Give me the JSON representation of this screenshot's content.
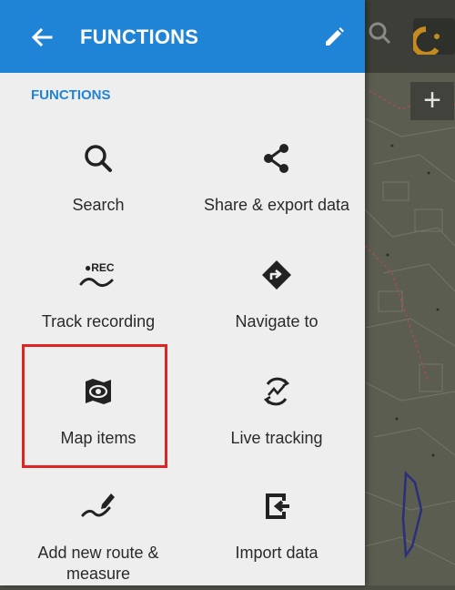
{
  "header": {
    "title": "FUNCTIONS",
    "back_icon": "arrow-back-icon",
    "edit_icon": "pencil-icon",
    "background_color": "#1f84d6"
  },
  "section": {
    "title": "FUNCTIONS"
  },
  "functions": [
    {
      "label": "Search",
      "icon": "search-icon"
    },
    {
      "label": "Share & export data",
      "icon": "share-icon"
    },
    {
      "label": "Track recording",
      "icon": "track-recording-icon",
      "icon_text": "●REC"
    },
    {
      "label": "Navigate to",
      "icon": "navigate-icon"
    },
    {
      "label": "Map items",
      "icon": "map-items-icon",
      "highlighted": true
    },
    {
      "label": "Live tracking",
      "icon": "live-tracking-icon"
    },
    {
      "label": "Add new route & measure",
      "icon": "route-planner-icon"
    },
    {
      "label": "Import data",
      "icon": "import-icon"
    }
  ],
  "highlight_color": "#e02424"
}
